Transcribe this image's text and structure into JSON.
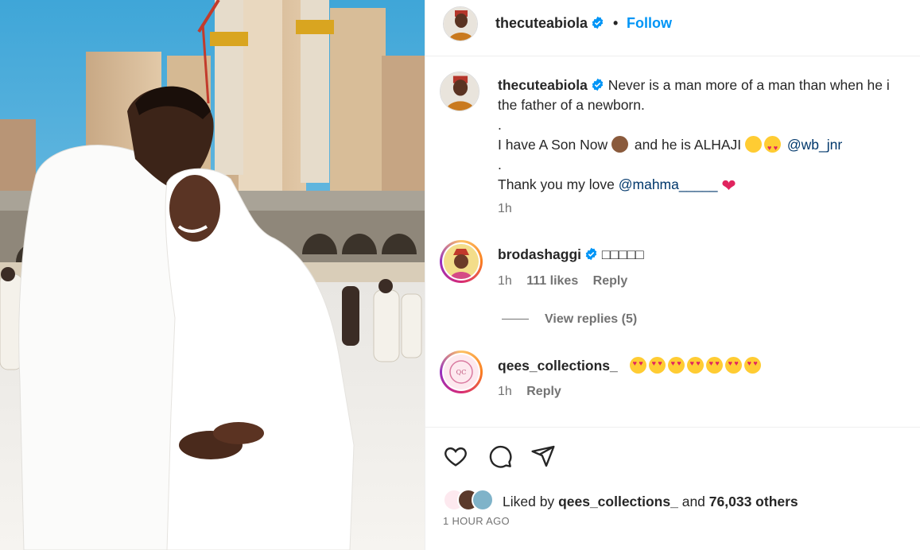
{
  "post": {
    "author": "thecuteabiola",
    "follow_label": "Follow",
    "dot": "•"
  },
  "caption": {
    "username": "thecuteabiola",
    "line1": "Never is a man more of a man than when he i",
    "line2": "the father of a newborn.",
    "line3": ".",
    "line4_a": "I have A Son Now",
    "line4_b": "and he is ALHAJI",
    "line4_mention": "@wb_jnr",
    "line5": ".",
    "line6_a": "Thank you my love",
    "line6_mention": "@mahma_____",
    "time": "1h"
  },
  "comments": [
    {
      "username": "brodashaggi",
      "text": "□□□□□",
      "time": "1h",
      "likes": "111 likes",
      "reply": "Reply",
      "view_replies": "View replies (5)"
    },
    {
      "username": "qees_collections_",
      "time": "1h",
      "reply": "Reply"
    }
  ],
  "footer": {
    "liked_by": "Liked by",
    "liker": "qees_collections_",
    "and": "and",
    "others": "76,033 others",
    "timestamp": "1 HOUR AGO"
  },
  "icons": {
    "like": "heart-icon",
    "comment": "comment-icon",
    "share": "share-icon",
    "verified": "verified-badge-icon"
  },
  "colors": {
    "accent": "#0095f6",
    "mention": "#00376b",
    "muted": "#737373",
    "verified": "#0095f6"
  }
}
